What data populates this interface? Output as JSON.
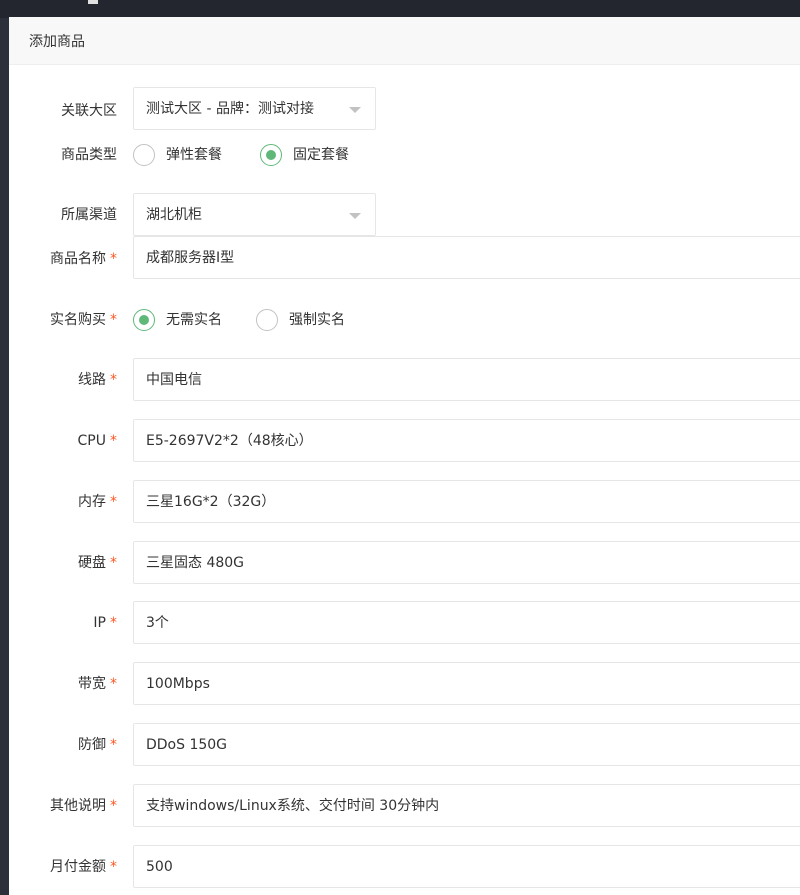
{
  "dialog": {
    "title": "添加商品"
  },
  "form": {
    "region": {
      "label": "关联大区",
      "value": "测试大区 - 品牌：测试对接"
    },
    "product_type": {
      "label": "商品类型",
      "options": [
        {
          "label": "弹性套餐",
          "selected": false
        },
        {
          "label": "固定套餐",
          "selected": true
        }
      ]
    },
    "channel": {
      "label": "所属渠道",
      "value": "湖北机柜"
    },
    "name": {
      "label": "商品名称",
      "required": "*",
      "value": "成都服务器I型"
    },
    "real_name": {
      "label": "实名购买",
      "required": "*",
      "options": [
        {
          "label": "无需实名",
          "selected": true
        },
        {
          "label": "强制实名",
          "selected": false
        }
      ]
    },
    "line": {
      "label": "线路",
      "required": "*",
      "value": "中国电信"
    },
    "cpu": {
      "label": "CPU",
      "required": "*",
      "value": "E5-2697V2*2（48核心）"
    },
    "memory": {
      "label": "内存",
      "required": "*",
      "value": "三星16G*2（32G）"
    },
    "disk": {
      "label": "硬盘",
      "required": "*",
      "value": "三星固态 480G"
    },
    "ip": {
      "label": "IP",
      "required": "*",
      "value": "3个"
    },
    "bandwidth": {
      "label": "带宽",
      "required": "*",
      "value": "100Mbps"
    },
    "defense": {
      "label": "防御",
      "required": "*",
      "value": "DDoS 150G"
    },
    "notes": {
      "label": "其他说明",
      "required": "*",
      "value": "支持windows/Linux系统、交付时间 30分钟内"
    },
    "monthly_price": {
      "label": "月付金额",
      "required": "*",
      "value": "500"
    }
  },
  "colors": {
    "accent": "#5fb878",
    "required": "#ff5722",
    "border": "#e6e6e6",
    "backdrop": "#2b303b"
  }
}
